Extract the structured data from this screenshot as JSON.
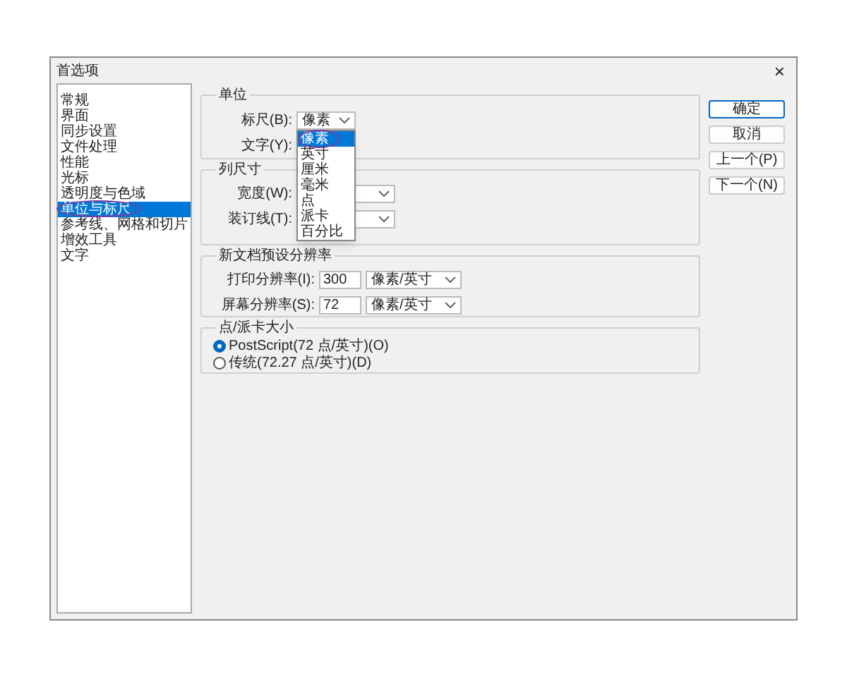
{
  "window": {
    "title": "首选项",
    "close": "×"
  },
  "sidebar": {
    "items": [
      {
        "label": "常规",
        "selected": false,
        "circled": false
      },
      {
        "label": "界面",
        "selected": false,
        "circled": false
      },
      {
        "label": "同步设置",
        "selected": false,
        "circled": false
      },
      {
        "label": "文件处理",
        "selected": false,
        "circled": false
      },
      {
        "label": "性能",
        "selected": false,
        "circled": false
      },
      {
        "label": "光标",
        "selected": false,
        "circled": false
      },
      {
        "label": "透明度与色域",
        "selected": false,
        "circled": false
      },
      {
        "label": "单位与标尺",
        "selected": true,
        "circled": true
      },
      {
        "label": "参考线、网格和切片",
        "selected": false,
        "circled": false
      },
      {
        "label": "增效工具",
        "selected": false,
        "circled": false
      },
      {
        "label": "文字",
        "selected": false,
        "circled": false
      }
    ]
  },
  "units": {
    "title": "单位",
    "ruler": {
      "label": "标尺(B):",
      "value": "像素",
      "options": [
        {
          "label": "像素",
          "selected": true,
          "circled": true
        },
        {
          "label": "英寸",
          "selected": false,
          "circled": false
        },
        {
          "label": "厘米",
          "selected": false,
          "circled": false
        },
        {
          "label": "毫米",
          "selected": false,
          "circled": false
        },
        {
          "label": "点",
          "selected": false,
          "circled": false
        },
        {
          "label": "派卡",
          "selected": false,
          "circled": false
        },
        {
          "label": "百分比",
          "selected": false,
          "circled": false
        }
      ]
    },
    "type": {
      "label": "文字(Y):"
    }
  },
  "column_size": {
    "title": "列尺寸",
    "fields": [
      {
        "label": "宽度(W):"
      },
      {
        "label": "装订线(T):"
      }
    ]
  },
  "resolution": {
    "title": "新文档预设分辨率",
    "fields": [
      {
        "label": "打印分辨率(I):",
        "value": "300",
        "unit": "像素/英寸"
      },
      {
        "label": "屏幕分辨率(S):",
        "value": "72",
        "unit": "像素/英寸"
      }
    ]
  },
  "point_size": {
    "title": "点/派卡大小",
    "options": [
      {
        "label": "PostScript(72 点/英寸)(O)",
        "selected": true
      },
      {
        "label": "传统(72.27 点/英寸)(D)",
        "selected": false
      }
    ]
  },
  "buttons": [
    {
      "label": "确定",
      "default": true
    },
    {
      "label": "取消",
      "default": false
    },
    {
      "label": "上一个(P)",
      "default": false
    },
    {
      "label": "下一个(N)",
      "default": false
    }
  ]
}
